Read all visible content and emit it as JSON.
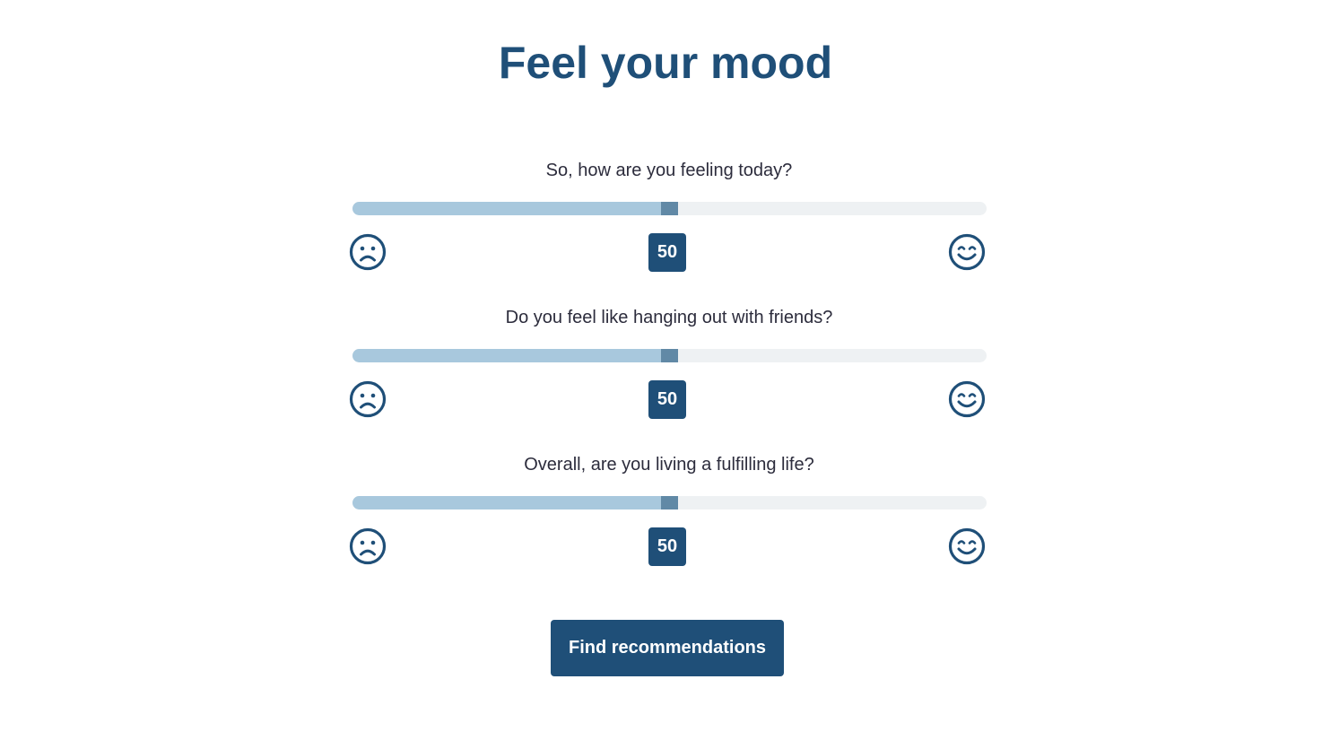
{
  "page": {
    "title": "Feel your mood"
  },
  "questions": [
    {
      "label": "So, how are you feeling today?",
      "value": "50",
      "slider_fraction": 0.5,
      "low_icon": "sad-face-icon",
      "high_icon": "happy-face-icon"
    },
    {
      "label": "Do you feel like hanging out with friends?",
      "value": "50",
      "slider_fraction": 0.5,
      "low_icon": "sad-face-icon",
      "high_icon": "happy-face-icon"
    },
    {
      "label": "Overall, are you living a fulfilling life?",
      "value": "50",
      "slider_fraction": 0.5,
      "low_icon": "sad-face-icon",
      "high_icon": "happy-face-icon"
    }
  ],
  "actions": {
    "find_label": "Find recommendations"
  },
  "colors": {
    "primary": "#1f4f78",
    "track": "#eef1f3",
    "track_fill": "#a8c8dd",
    "thumb": "#6189a6",
    "question_text": "#2c2c3c"
  }
}
